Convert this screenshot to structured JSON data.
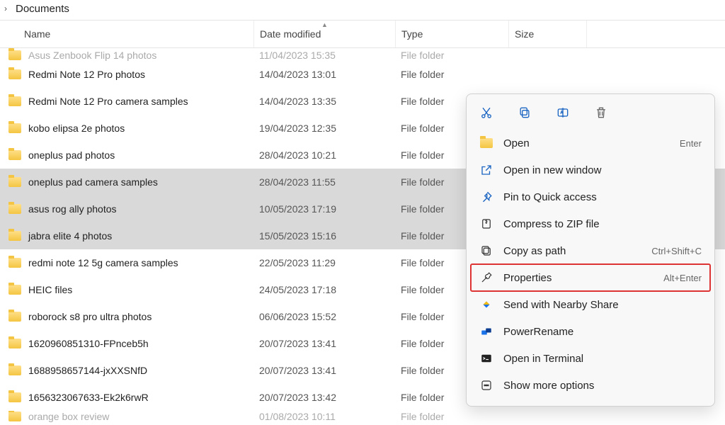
{
  "breadcrumb": {
    "current": "Documents"
  },
  "columns": {
    "name": "Name",
    "date": "Date modified",
    "type": "Type",
    "size": "Size"
  },
  "entries": [
    {
      "name": "Asus Zenbook Flip 14 photos",
      "date": "11/04/2023 15:35",
      "type": "File folder",
      "selected": false,
      "clipped": "top"
    },
    {
      "name": "Redmi Note 12 Pro photos",
      "date": "14/04/2023 13:01",
      "type": "File folder",
      "selected": false
    },
    {
      "name": "Redmi Note 12 Pro camera samples",
      "date": "14/04/2023 13:35",
      "type": "File folder",
      "selected": false
    },
    {
      "name": "kobo elipsa 2e photos",
      "date": "19/04/2023 12:35",
      "type": "File folder",
      "selected": false
    },
    {
      "name": "oneplus pad photos",
      "date": "28/04/2023 10:21",
      "type": "File folder",
      "selected": false
    },
    {
      "name": "oneplus pad camera samples",
      "date": "28/04/2023 11:55",
      "type": "File folder",
      "selected": true
    },
    {
      "name": "asus rog ally photos",
      "date": "10/05/2023 17:19",
      "type": "File folder",
      "selected": true
    },
    {
      "name": "jabra elite 4 photos",
      "date": "15/05/2023 15:16",
      "type": "File folder",
      "selected": true
    },
    {
      "name": "redmi note 12 5g camera samples",
      "date": "22/05/2023 11:29",
      "type": "File folder",
      "selected": false
    },
    {
      "name": "HEIC files",
      "date": "24/05/2023 17:18",
      "type": "File folder",
      "selected": false
    },
    {
      "name": "roborock s8 pro ultra photos",
      "date": "06/06/2023 15:52",
      "type": "File folder",
      "selected": false
    },
    {
      "name": "1620960851310-FPnceb5h",
      "date": "20/07/2023 13:41",
      "type": "File folder",
      "selected": false
    },
    {
      "name": "1688958657144-jxXXSNfD",
      "date": "20/07/2023 13:41",
      "type": "File folder",
      "selected": false
    },
    {
      "name": "1656323067633-Ek2k6rwR",
      "date": "20/07/2023 13:42",
      "type": "File folder",
      "selected": false
    },
    {
      "name": "orange box review",
      "date": "01/08/2023 10:11",
      "type": "File folder",
      "selected": false,
      "clipped": "bottom"
    }
  ],
  "context_menu": {
    "items": [
      {
        "key": "open",
        "label": "Open",
        "shortcut": "Enter",
        "icon": "folder"
      },
      {
        "key": "open-new-window",
        "label": "Open in new window",
        "shortcut": "",
        "icon": "open-external"
      },
      {
        "key": "pin-quick",
        "label": "Pin to Quick access",
        "shortcut": "",
        "icon": "pin"
      },
      {
        "key": "compress-zip",
        "label": "Compress to ZIP file",
        "shortcut": "",
        "icon": "zip"
      },
      {
        "key": "copy-path",
        "label": "Copy as path",
        "shortcut": "Ctrl+Shift+C",
        "icon": "copy-path"
      },
      {
        "key": "properties",
        "label": "Properties",
        "shortcut": "Alt+Enter",
        "icon": "wrench",
        "highlighted": true
      },
      {
        "key": "nearby-share",
        "label": "Send with Nearby Share",
        "shortcut": "",
        "icon": "nearby"
      },
      {
        "key": "powerrename",
        "label": "PowerRename",
        "shortcut": "",
        "icon": "rename-tool"
      },
      {
        "key": "open-terminal",
        "label": "Open in Terminal",
        "shortcut": "",
        "icon": "terminal"
      },
      {
        "key": "more-options",
        "label": "Show more options",
        "shortcut": "",
        "icon": "more"
      }
    ]
  }
}
